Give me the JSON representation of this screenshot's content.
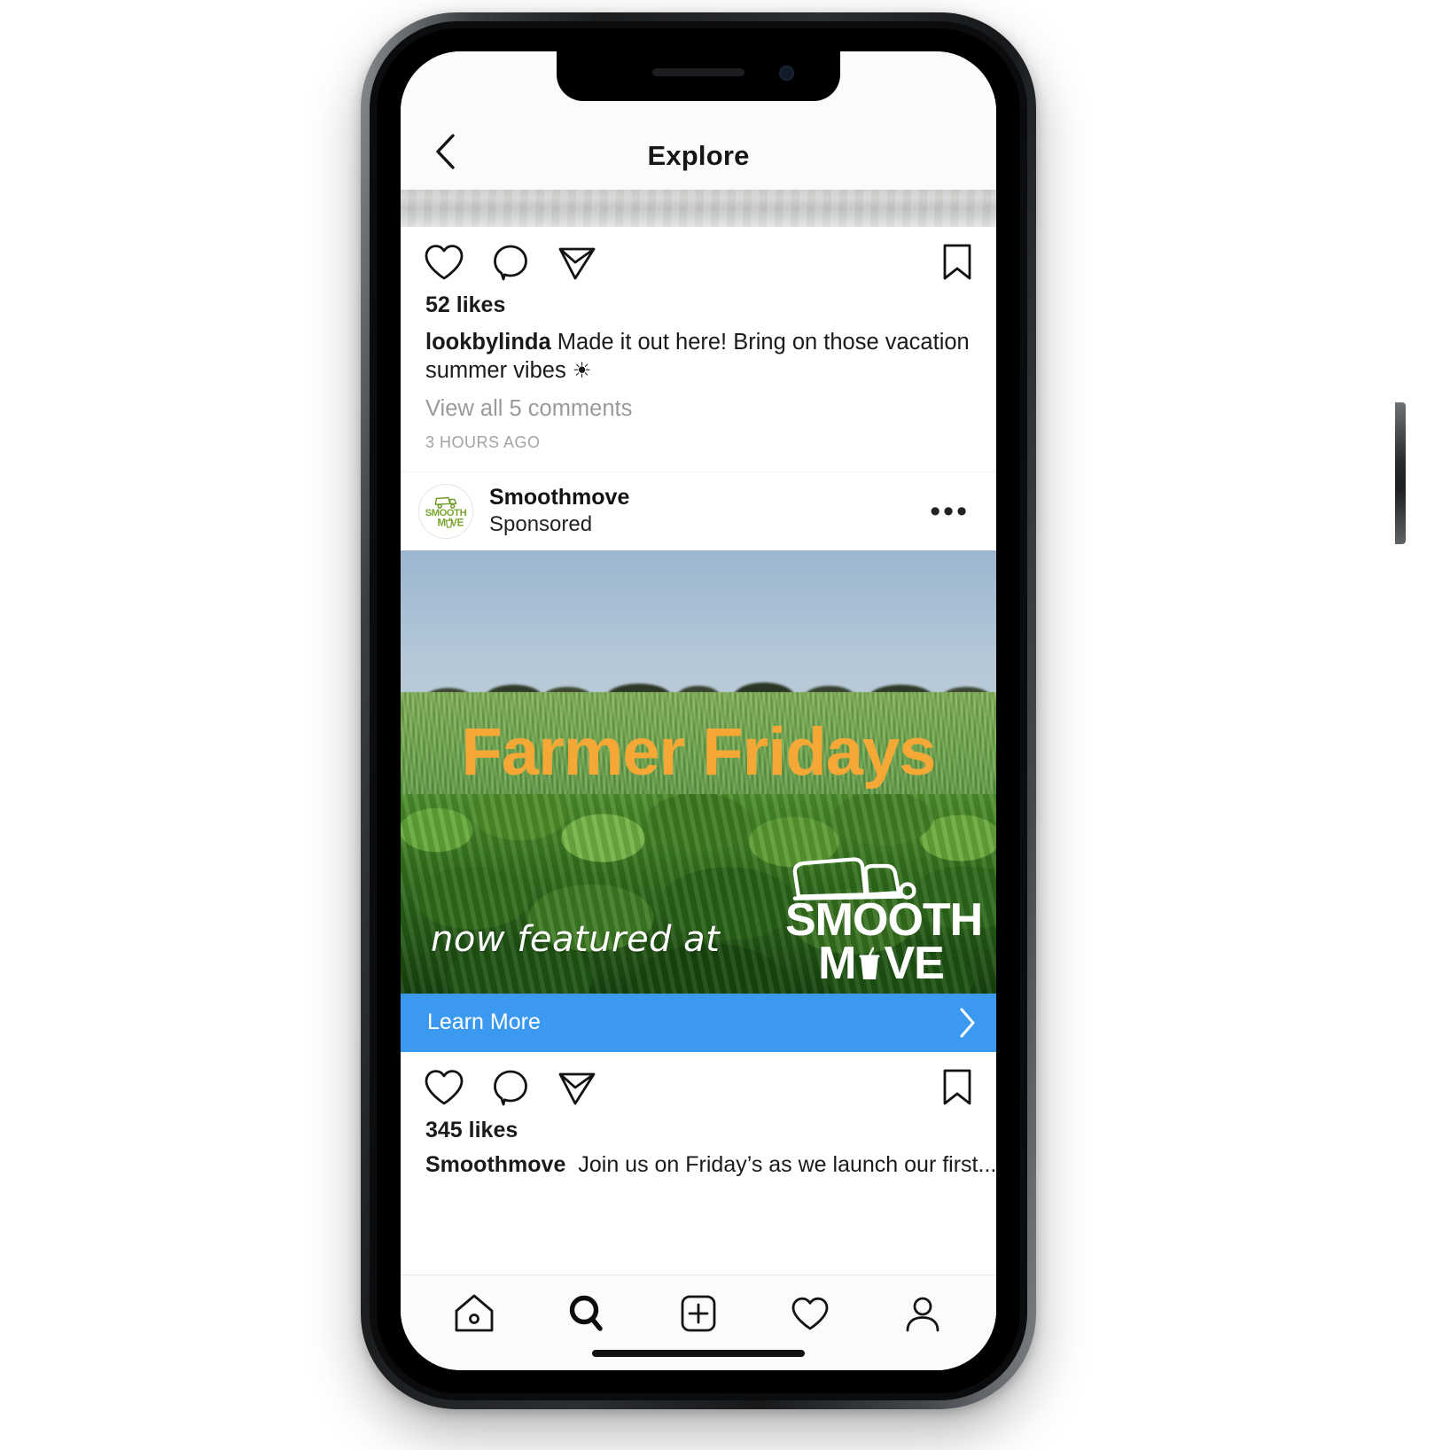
{
  "device": {
    "name": "iphone-x-mockup"
  },
  "app": {
    "navbar": {
      "title": "Explore",
      "back_icon": "chevron-left-icon"
    },
    "post_partial": {
      "likes": "52 likes",
      "username": "lookbylinda",
      "caption_text": "Made it out here! Bring on those vacation summer vibes",
      "caption_emoji": "☀",
      "view_comments": "View all 5 comments",
      "timestamp": "3 HOURS AGO",
      "actions": {
        "like": "heart-icon",
        "comment": "comment-bubble-icon",
        "share": "paper-plane-icon",
        "save": "bookmark-icon"
      }
    },
    "sponsored_post": {
      "header": {
        "account_name": "Smoothmove",
        "sponsored_label": "Sponsored",
        "avatar_line1": "SMOOTH",
        "avatar_line2": "M VE",
        "more_options": "•••"
      },
      "ad_creative": {
        "headline": "Farmer Fridays",
        "headline_color": "#F5A836",
        "subline": "now featured at",
        "logo_line1": "SMOOTH",
        "logo_line2_a": "M",
        "logo_line2_b": "VE",
        "alt": "green spinach crop field under blue sky with distant treeline"
      },
      "cta": {
        "label": "Learn More",
        "bg_color": "#3B9AF0",
        "chevron_icon": "chevron-right-icon"
      },
      "likes": "345 likes",
      "caption_username": "Smoothmove",
      "caption_text": "Join us on Friday’s as we launch our first...",
      "actions": {
        "like": "heart-icon",
        "comment": "comment-bubble-icon",
        "share": "paper-plane-icon",
        "save": "bookmark-icon"
      }
    },
    "tabbar": {
      "items": [
        {
          "name": "home-icon",
          "label": "Home",
          "active": false
        },
        {
          "name": "search-icon",
          "label": "Search",
          "active": true
        },
        {
          "name": "add-post-icon",
          "label": "New Post",
          "active": false
        },
        {
          "name": "activity-heart-icon",
          "label": "Activity",
          "active": false
        },
        {
          "name": "profile-icon",
          "label": "Profile",
          "active": false
        }
      ]
    }
  }
}
